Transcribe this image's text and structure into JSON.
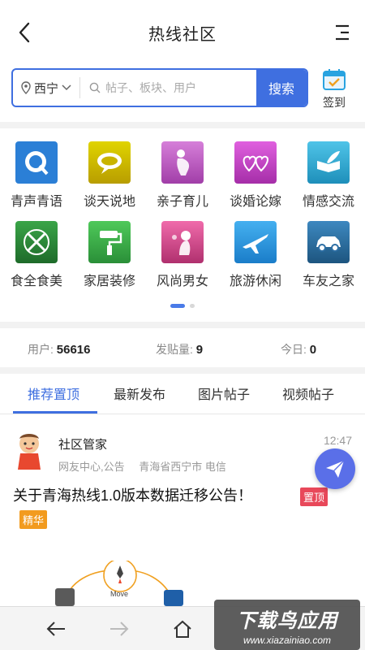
{
  "header": {
    "title": "热线社区"
  },
  "search": {
    "city": "西宁",
    "placeholder": "帖子、板块、用户",
    "button": "搜索"
  },
  "checkin": {
    "label": "签到"
  },
  "categories": [
    {
      "label": "青声青语",
      "icon": "q-voice-icon",
      "color": "#2b7fd6"
    },
    {
      "label": "谈天说地",
      "icon": "speech-bubble-icon",
      "color": "#c9b400"
    },
    {
      "label": "亲子育儿",
      "icon": "pregnant-mother-icon",
      "color": "#c25ec9"
    },
    {
      "label": "谈婚论嫁",
      "icon": "double-heart-icon",
      "color": "#c33fc4"
    },
    {
      "label": "情感交流",
      "icon": "feather-book-icon",
      "color": "#2aa3c8"
    },
    {
      "label": "食全食美",
      "icon": "fork-knife-icon",
      "color": "#2f8f3a"
    },
    {
      "label": "家居装修",
      "icon": "paint-roller-icon",
      "color": "#3aae48"
    },
    {
      "label": "风尚男女",
      "icon": "fashion-woman-icon",
      "color": "#d14a8a"
    },
    {
      "label": "旅游休闲",
      "icon": "airplane-icon",
      "color": "#2a8fe0"
    },
    {
      "label": "车友之家",
      "icon": "car-icon",
      "color": "#2d6ea3"
    }
  ],
  "stats": {
    "users_label": "用户:",
    "users_value": "56616",
    "posts_label": "发贴量:",
    "posts_value": "9",
    "today_label": "今日:",
    "today_value": "0"
  },
  "tabs": [
    {
      "label": "推荐置顶",
      "active": true
    },
    {
      "label": "最新发布",
      "active": false
    },
    {
      "label": "图片帖子",
      "active": false
    },
    {
      "label": "视频帖子",
      "active": false
    }
  ],
  "post": {
    "author": "社区管家",
    "time": "12:47",
    "source": "网友中心,公告",
    "location": "青海省西宁市 电信",
    "title": "关于青海热线1.0版本数据迁移公告！",
    "pin_badge": "置顶",
    "elite_badge": "精华",
    "preview_label": "Move"
  },
  "watermark": {
    "main": "下载鸟应用",
    "sub": "www.xiazainiao.com"
  }
}
